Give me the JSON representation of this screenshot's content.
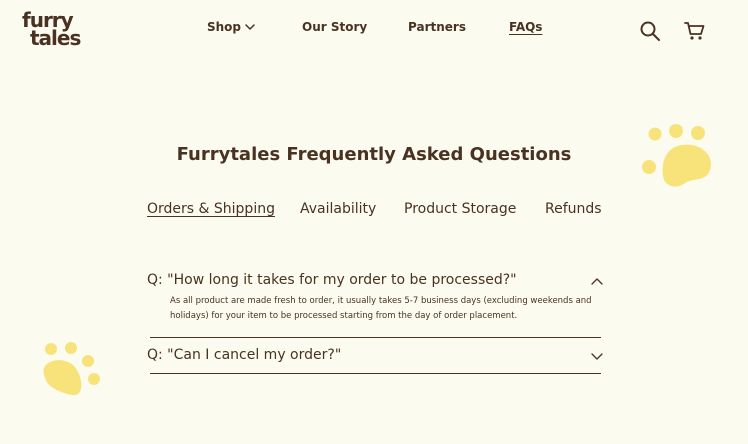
{
  "header": {
    "logo_line1": "furry",
    "logo_line2": "tales",
    "nav": [
      {
        "label": "Shop",
        "icon": "chevron-down-icon"
      },
      {
        "label": "Our Story"
      },
      {
        "label": "Partners"
      },
      {
        "label": "FAQs",
        "active": true
      }
    ],
    "icons": [
      "search-icon",
      "cart-icon"
    ]
  },
  "main": {
    "title": "Furrytales Frequently Asked Questions",
    "tabs": [
      {
        "label": "Orders & Shipping",
        "active": true
      },
      {
        "label": "Availability"
      },
      {
        "label": "Product Storage"
      },
      {
        "label": "Refunds"
      }
    ],
    "faqs": [
      {
        "question": "Q: \"How long it takes for my order to be processed?\"",
        "answer": "As all product are made fresh to order, it usually takes 5-7 business days (excluding weekends and holidays) for your item to be processed starting from the day of order placement.",
        "expanded": true
      },
      {
        "question": "Q: \"Can I cancel my order?\"",
        "expanded": false
      }
    ]
  },
  "colors": {
    "background": "#fbfbef",
    "text": "#4a3222",
    "paw": "#f8e37a"
  }
}
